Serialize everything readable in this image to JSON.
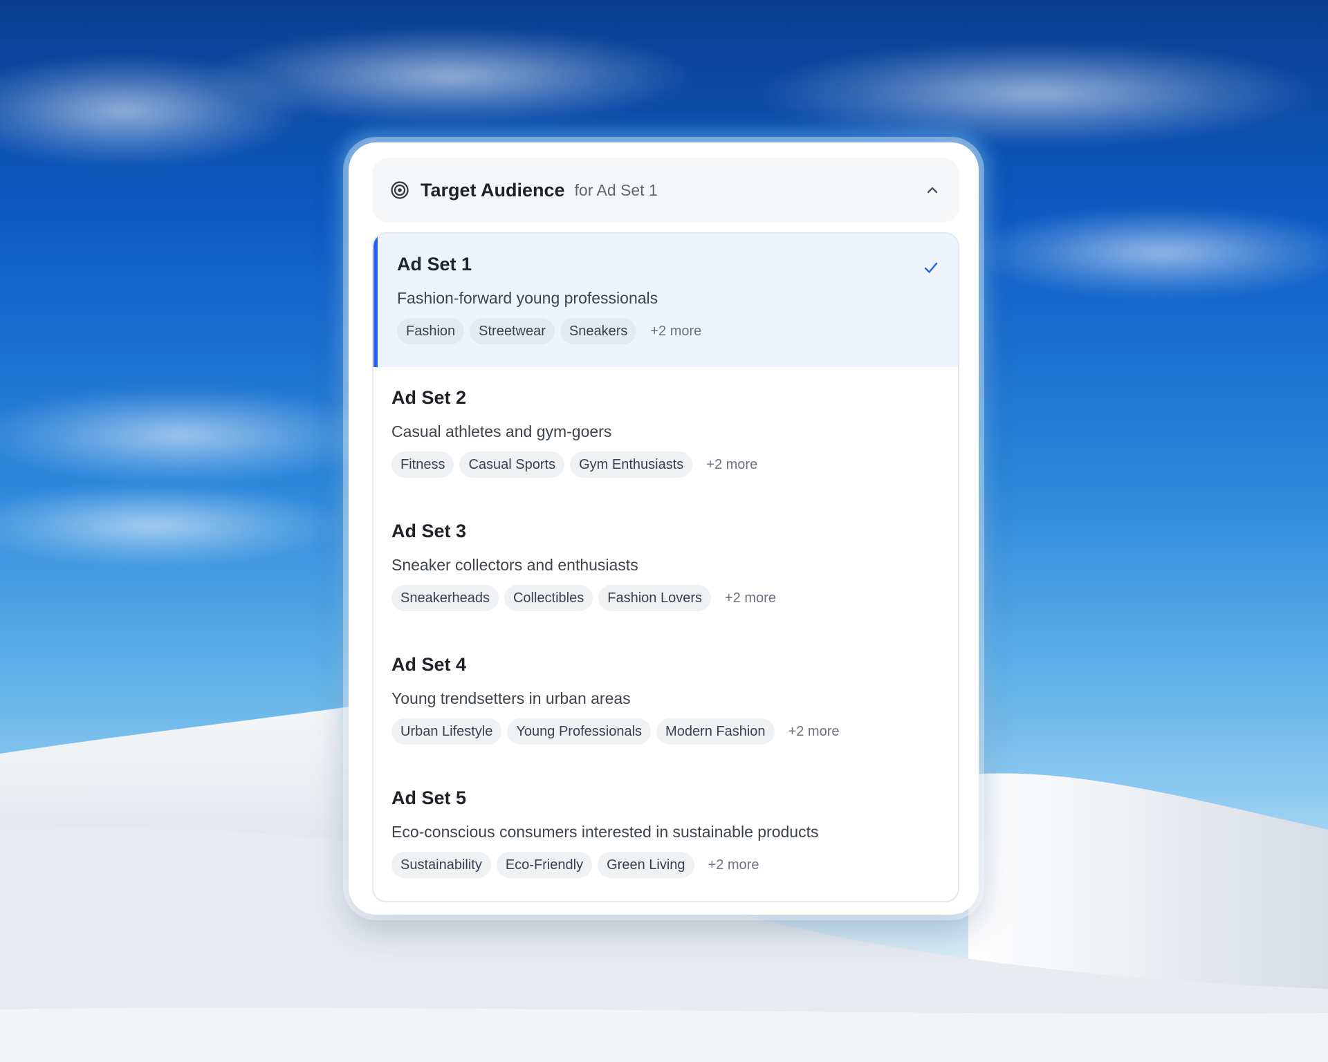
{
  "colors": {
    "accent": "#2563eb",
    "selected_bg": "#eef4fd",
    "card_bg": "#ffffff",
    "header_bg": "#f6f7f9",
    "tag_bg": "#f0f1f3",
    "text_primary": "#1f2329",
    "text_secondary": "#5f6670"
  },
  "header": {
    "icon": "target-icon",
    "title": "Target Audience",
    "subtitle": "for Ad Set 1",
    "toggle_icon": "chevron-up-icon"
  },
  "ad_sets": [
    {
      "name": "Ad Set 1",
      "description": "Fashion-forward young professionals",
      "tags": [
        "Fashion",
        "Streetwear",
        "Sneakers"
      ],
      "more": "+2 more",
      "selected": true,
      "selected_icon": "check-icon"
    },
    {
      "name": "Ad Set 2",
      "description": "Casual athletes and gym-goers",
      "tags": [
        "Fitness",
        "Casual Sports",
        "Gym Enthusiasts"
      ],
      "more": "+2 more",
      "selected": false
    },
    {
      "name": "Ad Set 3",
      "description": "Sneaker collectors and enthusiasts",
      "tags": [
        "Sneakerheads",
        "Collectibles",
        "Fashion Lovers"
      ],
      "more": "+2 more",
      "selected": false
    },
    {
      "name": "Ad Set 4",
      "description": "Young trendsetters in urban areas",
      "tags": [
        "Urban Lifestyle",
        "Young Professionals",
        "Modern Fashion"
      ],
      "more": "+2 more",
      "selected": false
    },
    {
      "name": "Ad Set 5",
      "description": "Eco-conscious consumers interested in sustainable products",
      "tags": [
        "Sustainability",
        "Eco-Friendly",
        "Green Living"
      ],
      "more": "+2 more",
      "selected": false
    }
  ]
}
